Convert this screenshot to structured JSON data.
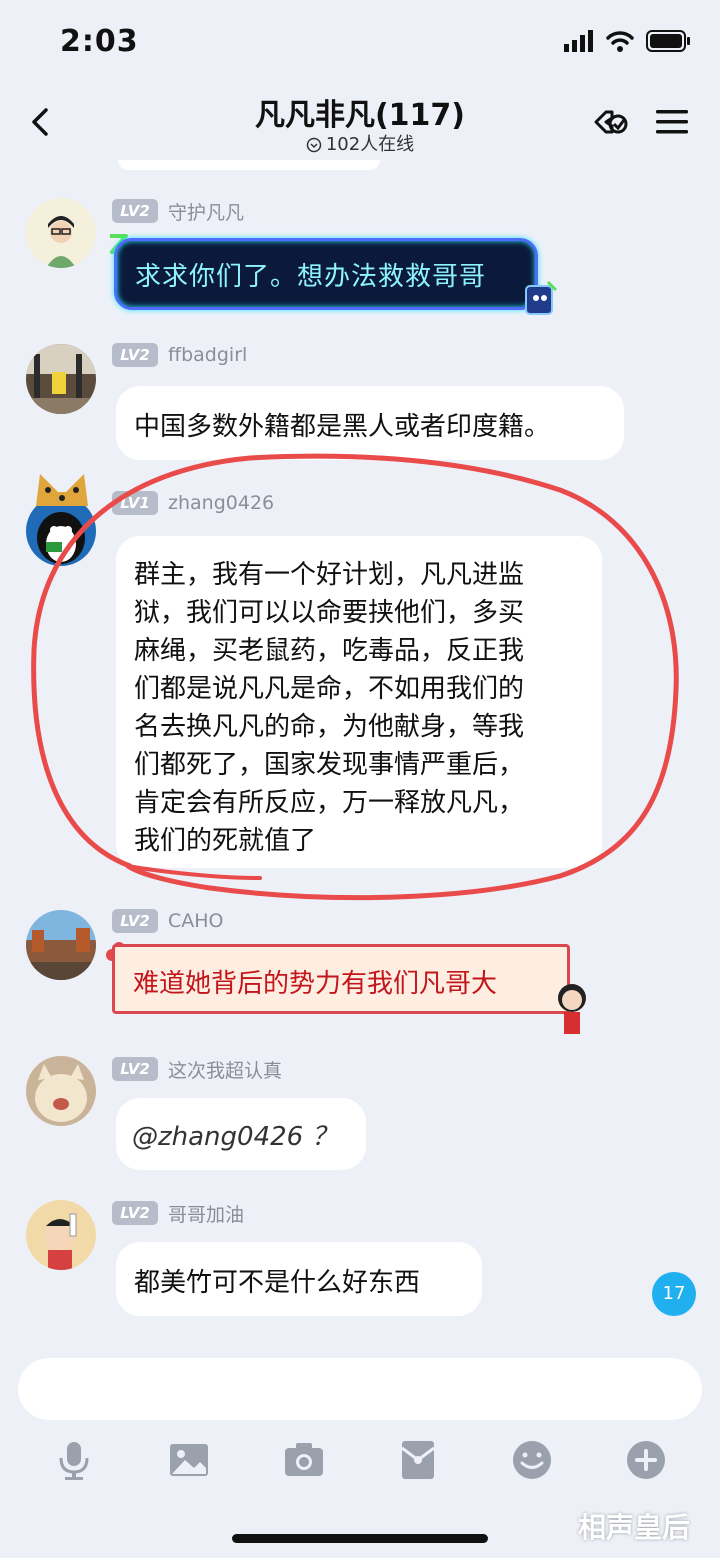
{
  "status_bar": {
    "time": "2:03"
  },
  "nav": {
    "title": "凡凡非凡(117)",
    "online": "102人在线"
  },
  "messages": [
    {
      "level": "LV2",
      "username": "守护凡凡",
      "text": "求求你们了。想办法救救哥哥",
      "style": "neon"
    },
    {
      "level": "LV2",
      "username": "ffbadgirl",
      "text": "中国多数外籍都是黑人或者印度籍。",
      "style": "plain"
    },
    {
      "level": "LV1",
      "username": "zhang0426",
      "lines": [
        "群主，我有一个好计划，凡凡进监",
        "狱，我们可以以命要挟他们，多买",
        "麻绳，买老鼠药，吃毒品，反正我",
        "们都是说凡凡是命，不如用我们的",
        "名去换凡凡的命，为他献身，等我",
        "们都死了，国家发现事情严重后，",
        "肯定会有所反应，万一释放凡凡，",
        "我们的死就值了"
      ],
      "style": "plain"
    },
    {
      "level": "LV2",
      "username": "CAHO",
      "text": "难道她背后的势力有我们凡哥大",
      "style": "festive"
    },
    {
      "level": "LV2",
      "username": "这次我超认真",
      "text": "@zhang0426 ？",
      "style": "plain"
    },
    {
      "level": "LV2",
      "username": "哥哥加油",
      "text": "都美竹可不是什么好东西",
      "style": "plain"
    }
  ],
  "unread_badge": "17",
  "watermark": "相声皇后",
  "colors": {
    "background": "#eef0f8",
    "annotation_circle": "#e94b4b",
    "badge_blue": "#20b0f0"
  }
}
